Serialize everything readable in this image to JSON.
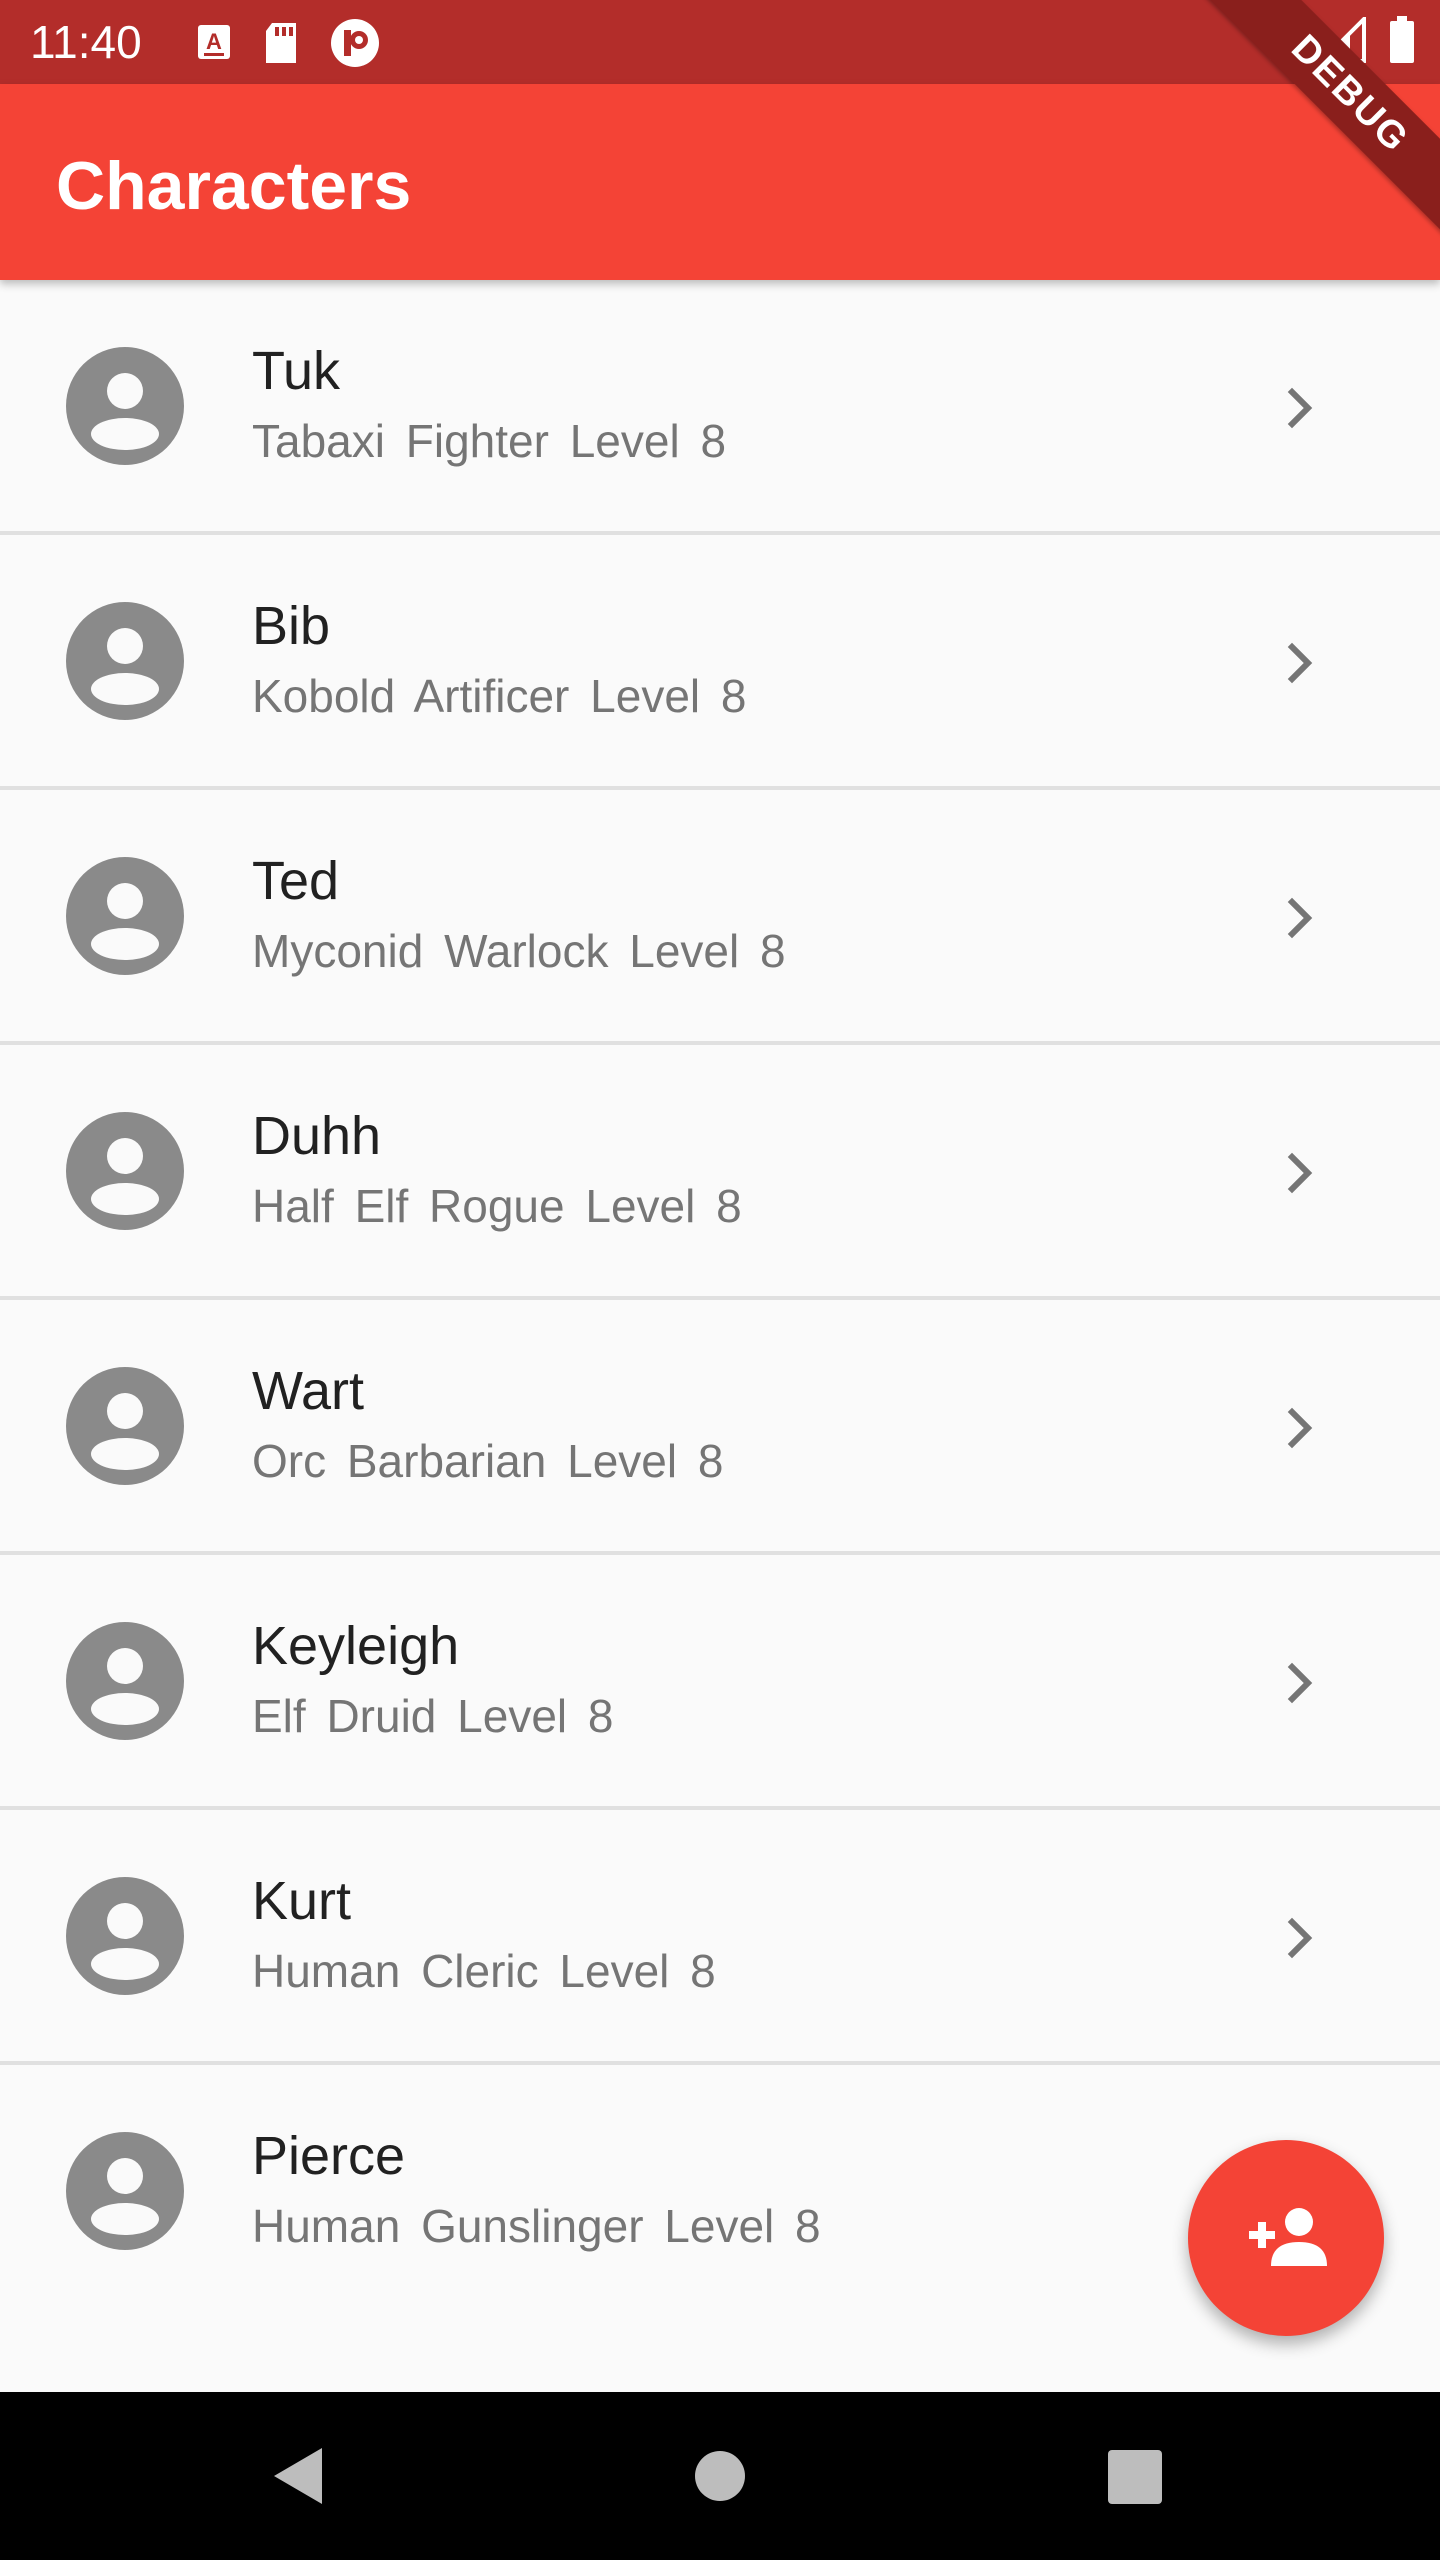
{
  "status_bar": {
    "time": "11:40",
    "left_icons": [
      "a-download-icon",
      "sd-card-icon",
      "circle-app-icon"
    ],
    "right_icons": [
      "wifi-icon",
      "cell-signal-icon",
      "battery-icon"
    ],
    "color": "#b32d2a"
  },
  "app_bar": {
    "title": "Characters",
    "color": "#f44336"
  },
  "debug_banner": {
    "label": "DEBUG"
  },
  "characters": [
    {
      "name": "Tuk",
      "subtitle": "Tabaxi Fighter Level 8"
    },
    {
      "name": "Bib",
      "subtitle": "Kobold Artificer Level 8"
    },
    {
      "name": "Ted",
      "subtitle": "Myconid Warlock Level 8"
    },
    {
      "name": "Duhh",
      "subtitle": "Half Elf Rogue Level 8"
    },
    {
      "name": "Wart",
      "subtitle": "Orc Barbarian Level 8"
    },
    {
      "name": "Keyleigh",
      "subtitle": "Elf Druid Level 8"
    },
    {
      "name": "Kurt",
      "subtitle": "Human Cleric Level 8"
    },
    {
      "name": "Pierce",
      "subtitle": "Human Gunslinger Level 8"
    }
  ],
  "fab": {
    "icon": "person-add-icon",
    "color": "#f44336"
  },
  "nav_bar": {
    "icons": [
      "back-icon",
      "home-icon",
      "recents-icon"
    ]
  }
}
